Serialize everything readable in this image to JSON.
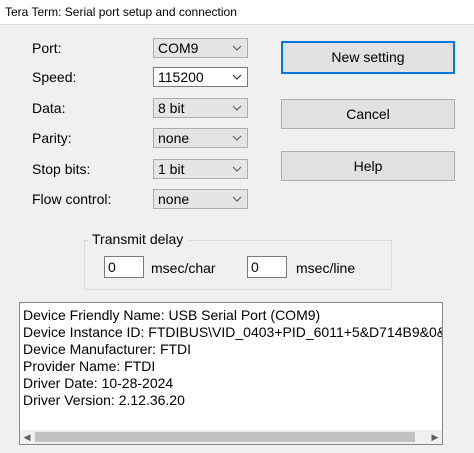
{
  "window": {
    "title": "Tera Term: Serial port setup and connection"
  },
  "fields": {
    "port": {
      "label": "Port:",
      "value": "COM9"
    },
    "speed": {
      "label": "Speed:",
      "value": "115200"
    },
    "data": {
      "label": "Data:",
      "value": "8 bit"
    },
    "parity": {
      "label": "Parity:",
      "value": "none"
    },
    "stop": {
      "label": "Stop bits:",
      "value": "1 bit"
    },
    "flow": {
      "label": "Flow control:",
      "value": "none"
    }
  },
  "buttons": {
    "new_setting": "New setting",
    "cancel": "Cancel",
    "help": "Help"
  },
  "transmit_delay": {
    "label": "Transmit delay",
    "char_value": "0",
    "char_unit": "msec/char",
    "line_value": "0",
    "line_unit": "msec/line"
  },
  "device_info": [
    "Device Friendly Name: USB Serial Port (COM9)",
    "Device Instance ID: FTDIBUS\\VID_0403+PID_6011+5&D714B9&0&",
    "Device Manufacturer: FTDI",
    "Provider Name: FTDI",
    "Driver Date: 10-28-2024",
    "Driver Version: 2.12.36.20"
  ],
  "icons": {
    "dropdown": "chevron-down-icon",
    "scroll_left": "scroll-left-arrow-icon",
    "scroll_right": "scroll-right-arrow-icon"
  },
  "colors": {
    "dialog_bg": "#f0f0f0",
    "default_button_border": "#0078d7",
    "button_bg": "#e1e1e1"
  }
}
